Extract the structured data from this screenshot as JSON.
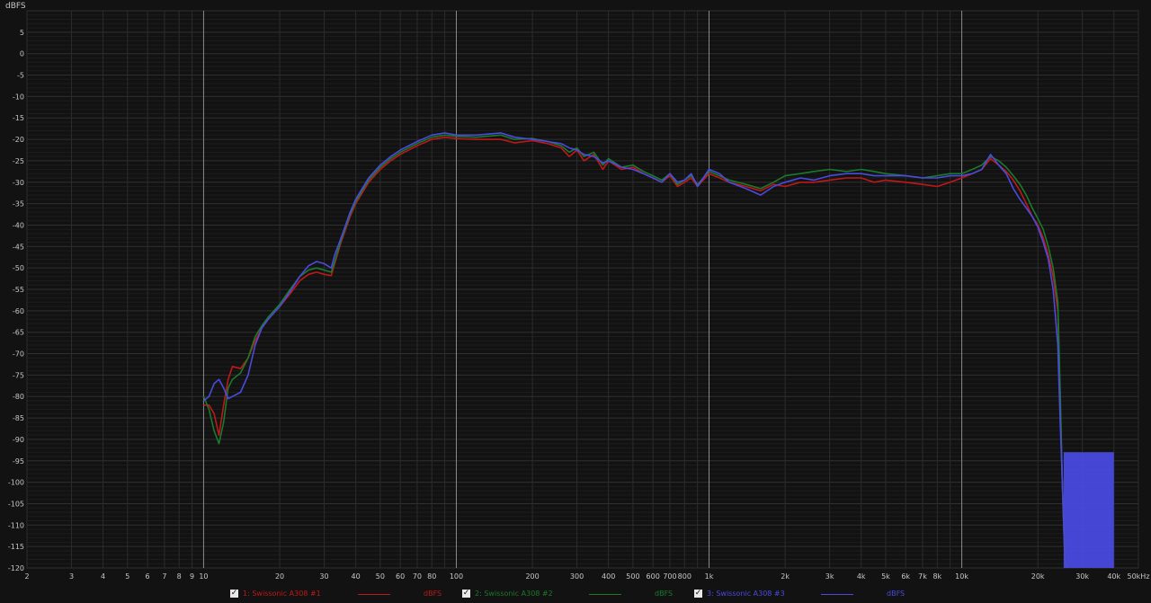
{
  "chart_data": {
    "type": "line",
    "ylabel": "dBFS",
    "ylim": [
      -120,
      10
    ],
    "xlim": [
      2,
      50000
    ],
    "xscale": "log",
    "grid": true,
    "y_ticks": [
      10,
      5,
      0,
      -5,
      -10,
      -15,
      -20,
      -25,
      -30,
      -35,
      -40,
      -45,
      -50,
      -55,
      -60,
      -65,
      -70,
      -75,
      -80,
      -85,
      -90,
      -95,
      -100,
      -105,
      -110,
      -115,
      -120
    ],
    "y_tick_labels": [
      "",
      "5",
      "0",
      "-5",
      "-10",
      "-15",
      "-20",
      "-25",
      "-30",
      "-35",
      "-40",
      "-45",
      "-50",
      "-55",
      "-60",
      "-65",
      "-70",
      "-75",
      "-80",
      "-85",
      "-90",
      "-95",
      "-100",
      "-105",
      "-110",
      "-115",
      "-120"
    ],
    "x_ticks": [
      {
        "v": 2,
        "label": "2"
      },
      {
        "v": 3,
        "label": "3"
      },
      {
        "v": 4,
        "label": "4"
      },
      {
        "v": 5,
        "label": "5"
      },
      {
        "v": 6,
        "label": "6"
      },
      {
        "v": 7,
        "label": "7"
      },
      {
        "v": 8,
        "label": "8"
      },
      {
        "v": 9,
        "label": "9"
      },
      {
        "v": 10,
        "label": "10"
      },
      {
        "v": 20,
        "label": "20"
      },
      {
        "v": 30,
        "label": "30"
      },
      {
        "v": 40,
        "label": "40"
      },
      {
        "v": 50,
        "label": "50"
      },
      {
        "v": 60,
        "label": "60"
      },
      {
        "v": 70,
        "label": "70"
      },
      {
        "v": 80,
        "label": "80"
      },
      {
        "v": 100,
        "label": "100"
      },
      {
        "v": 200,
        "label": "200"
      },
      {
        "v": 300,
        "label": "300"
      },
      {
        "v": 400,
        "label": "400"
      },
      {
        "v": 500,
        "label": "500"
      },
      {
        "v": 600,
        "label": "600"
      },
      {
        "v": 700,
        "label": "700"
      },
      {
        "v": 800,
        "label": "800"
      },
      {
        "v": 1000,
        "label": "1k"
      },
      {
        "v": 2000,
        "label": "2k"
      },
      {
        "v": 3000,
        "label": "3k"
      },
      {
        "v": 4000,
        "label": "4k"
      },
      {
        "v": 5000,
        "label": "5k"
      },
      {
        "v": 6000,
        "label": "6k"
      },
      {
        "v": 7000,
        "label": "7k"
      },
      {
        "v": 8000,
        "label": "8k"
      },
      {
        "v": 10000,
        "label": "10k"
      },
      {
        "v": 20000,
        "label": "20k"
      },
      {
        "v": 30000,
        "label": "30k"
      },
      {
        "v": 40000,
        "label": "40k"
      },
      {
        "v": 50000,
        "label": "50kHz"
      }
    ],
    "series": [
      {
        "name": "1: Swissonic A308 #1",
        "unit": "dBFS",
        "color": "#c01818",
        "checked": true,
        "x": [
          10,
          10.5,
          11,
          11.5,
          12,
          12.5,
          13,
          14,
          15,
          16,
          17,
          18,
          20,
          22,
          24,
          26,
          28,
          30,
          32,
          33,
          35,
          38,
          40,
          45,
          50,
          55,
          60,
          70,
          80,
          90,
          100,
          120,
          150,
          170,
          200,
          230,
          260,
          280,
          300,
          320,
          350,
          380,
          400,
          450,
          500,
          550,
          600,
          650,
          700,
          750,
          800,
          850,
          900,
          1000,
          1100,
          1200,
          1400,
          1600,
          1800,
          2000,
          2300,
          2600,
          3000,
          3500,
          4000,
          4500,
          5000,
          6000,
          7000,
          8000,
          9000,
          10000,
          11000,
          12000,
          13000,
          14000,
          15000,
          16000,
          17000,
          18000,
          19000,
          20000,
          21000,
          22000,
          23000,
          24000,
          24500,
          25000,
          25300,
          25600,
          26000
        ],
        "y": [
          -82,
          -82,
          -84,
          -89,
          -82,
          -76,
          -73,
          -73.5,
          -71,
          -67,
          -64,
          -62,
          -59,
          -56,
          -53,
          -51.5,
          -51,
          -51.5,
          -51.8,
          -49,
          -44,
          -38,
          -35,
          -30,
          -27,
          -25,
          -23.5,
          -21.5,
          -20,
          -19.5,
          -19.8,
          -20,
          -20,
          -20.8,
          -20.3,
          -21,
          -22,
          -24,
          -22.5,
          -25,
          -23.5,
          -27,
          -25,
          -27,
          -26.5,
          -28,
          -29,
          -30,
          -28.5,
          -31,
          -30,
          -29,
          -31,
          -28,
          -29,
          -30,
          -31,
          -32,
          -30.5,
          -31,
          -30,
          -30,
          -29.5,
          -29,
          -29,
          -30,
          -29.5,
          -30,
          -30.5,
          -31,
          -30,
          -29,
          -28,
          -27,
          -24.5,
          -26,
          -27.5,
          -29.5,
          -32,
          -35,
          -38,
          -40,
          -43,
          -47,
          -52,
          -60,
          -80,
          -100,
          -110,
          -118,
          -120
        ]
      },
      {
        "name": "2: Swissonic A308 #2",
        "unit": "dBFS",
        "color": "#1a7a2a",
        "checked": true,
        "x": [
          10,
          10.5,
          11,
          11.5,
          12,
          12.5,
          13,
          14,
          15,
          16,
          17,
          18,
          20,
          22,
          24,
          26,
          28,
          30,
          32,
          33,
          35,
          38,
          40,
          45,
          50,
          55,
          60,
          70,
          80,
          90,
          100,
          120,
          150,
          170,
          200,
          230,
          260,
          280,
          300,
          320,
          350,
          380,
          400,
          450,
          500,
          550,
          600,
          650,
          700,
          750,
          800,
          850,
          900,
          1000,
          1100,
          1200,
          1400,
          1600,
          1800,
          2000,
          2300,
          2600,
          3000,
          3500,
          4000,
          4500,
          5000,
          6000,
          7000,
          8000,
          9000,
          10000,
          11000,
          12000,
          13000,
          14000,
          15000,
          16000,
          17000,
          18000,
          19000,
          20000,
          21000,
          22000,
          23000,
          24000,
          24500,
          25000,
          25300,
          25600,
          26000
        ],
        "y": [
          -80,
          -83,
          -88,
          -91,
          -86,
          -78,
          -76,
          -74.5,
          -71,
          -66,
          -63.5,
          -61.5,
          -58.5,
          -55,
          -52,
          -50.5,
          -50,
          -50.5,
          -51,
          -48.5,
          -43.5,
          -37.5,
          -34.5,
          -29.5,
          -26.5,
          -24.5,
          -23,
          -21,
          -19.5,
          -19,
          -19.3,
          -19.5,
          -19,
          -20,
          -19.8,
          -20.5,
          -21.5,
          -23,
          -22,
          -24,
          -23,
          -26,
          -24.5,
          -26.5,
          -26,
          -27.5,
          -28.5,
          -29.5,
          -28,
          -30.5,
          -29.5,
          -28.5,
          -30.5,
          -27.5,
          -28.5,
          -29.5,
          -30.5,
          -31.5,
          -30,
          -28.5,
          -28,
          -27.5,
          -27,
          -27.5,
          -27,
          -27.5,
          -28,
          -28.5,
          -29,
          -28.5,
          -28,
          -28,
          -27,
          -26,
          -24,
          -25,
          -26.5,
          -28.5,
          -30.5,
          -33,
          -36,
          -38.5,
          -41,
          -45,
          -50,
          -58,
          -78,
          -100,
          -110,
          -118,
          -120
        ]
      },
      {
        "name": "3: Swissonic A308 #3",
        "unit": "dBFS",
        "color": "#4a4ae0",
        "checked": true,
        "x": [
          10,
          10.5,
          11,
          11.5,
          12,
          12.5,
          13,
          14,
          15,
          16,
          17,
          18,
          20,
          22,
          24,
          26,
          28,
          30,
          32,
          33,
          35,
          38,
          40,
          45,
          50,
          55,
          60,
          70,
          80,
          90,
          100,
          120,
          150,
          170,
          200,
          230,
          260,
          280,
          300,
          320,
          350,
          380,
          400,
          450,
          500,
          550,
          600,
          650,
          700,
          750,
          800,
          850,
          900,
          1000,
          1100,
          1200,
          1400,
          1600,
          1800,
          2000,
          2300,
          2600,
          3000,
          3500,
          4000,
          4500,
          5000,
          6000,
          7000,
          8000,
          9000,
          10000,
          11000,
          12000,
          13000,
          14000,
          15000,
          16000,
          17000,
          18000,
          19000,
          20000,
          21000,
          22000,
          23000,
          24000,
          24500,
          25000,
          25300,
          25600,
          26000
        ],
        "y": [
          -81,
          -80,
          -77,
          -76,
          -78,
          -80.5,
          -80,
          -79,
          -75,
          -68,
          -64,
          -62,
          -59,
          -55.5,
          -52,
          -49.5,
          -48.5,
          -49,
          -50,
          -47,
          -43,
          -37,
          -34,
          -29,
          -26,
          -24,
          -22.5,
          -20.5,
          -19,
          -18.5,
          -19,
          -19,
          -18.5,
          -19.5,
          -20,
          -20.5,
          -21,
          -22,
          -22.5,
          -23.5,
          -24,
          -25.5,
          -25,
          -26.5,
          -27,
          -28,
          -29,
          -30,
          -28,
          -30,
          -29.5,
          -28,
          -31,
          -27,
          -28,
          -30,
          -31.5,
          -33,
          -31,
          -30,
          -29,
          -29.5,
          -28.5,
          -28,
          -28,
          -28.5,
          -28.5,
          -28.5,
          -29,
          -29,
          -28.5,
          -28.5,
          -28,
          -27,
          -23.5,
          -26,
          -28,
          -31.5,
          -34,
          -36,
          -38,
          -40.5,
          -44,
          -48,
          -55,
          -68,
          -85,
          -100,
          -110,
          -118,
          -120
        ]
      }
    ],
    "noise_band": {
      "x_start": 25300,
      "x_end": 40000,
      "y_top": -93,
      "y_bottom": -120,
      "color": "#4a4ae0"
    }
  },
  "legend": [
    {
      "checkbox": "✓",
      "label": "1: Swissonic A308 #1",
      "unit": "dBFS",
      "color": "#c01818"
    },
    {
      "checkbox": "✓",
      "label": "2: Swissonic A308 #2",
      "unit": "dBFS",
      "color": "#1a7a2a"
    },
    {
      "checkbox": "✓",
      "label": "3: Swissonic A308 #3",
      "unit": "dBFS",
      "color": "#4a4ae0"
    }
  ]
}
